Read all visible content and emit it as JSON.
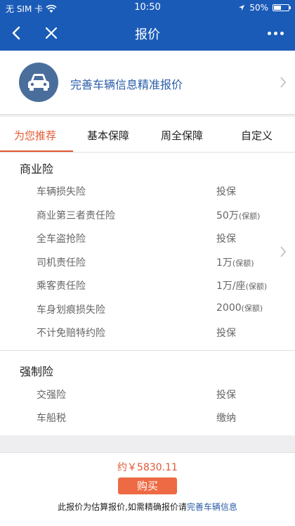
{
  "statusbar": {
    "carrier": "无 SIM 卡",
    "time": "10:50",
    "battery": "50%",
    "battery_level": 0.5
  },
  "navbar": {
    "title": "报价"
  },
  "banner": {
    "text": "完善车辆信息精准报价"
  },
  "tabs": [
    {
      "label": "为您推荐"
    },
    {
      "label": "基本保障"
    },
    {
      "label": "周全保障"
    },
    {
      "label": "自定义"
    }
  ],
  "commercial": {
    "title": "商业险",
    "items": [
      {
        "name": "车辆损失险",
        "value": "投保",
        "note": ""
      },
      {
        "name": "商业第三者责任险",
        "value": "50万",
        "note": "(保额)"
      },
      {
        "name": "全车盗抢险",
        "value": "投保",
        "note": ""
      },
      {
        "name": "司机责任险",
        "value": "1万",
        "note": "(保额)"
      },
      {
        "name": "乘客责任险",
        "value": "1万/座",
        "note": "(保额)"
      },
      {
        "name": "车身划痕损失险",
        "value": "2000",
        "note": "(保额)"
      },
      {
        "name": "不计免赔特约险",
        "value": "投保",
        "note": ""
      }
    ]
  },
  "compulsory": {
    "title": "强制险",
    "items": [
      {
        "name": "交强险",
        "value": "投保"
      },
      {
        "name": "车船税",
        "value": "缴纳"
      }
    ]
  },
  "footer": {
    "price": "约￥5830.11",
    "buy_label": "购买",
    "note_text": "此报价为估算报价,如需精确报价请",
    "note_link": "完善车辆信息"
  },
  "colors": {
    "primary": "#1b5bb8",
    "accent": "#e05a33",
    "button": "#ee6a44",
    "link": "#2a5ca8"
  }
}
